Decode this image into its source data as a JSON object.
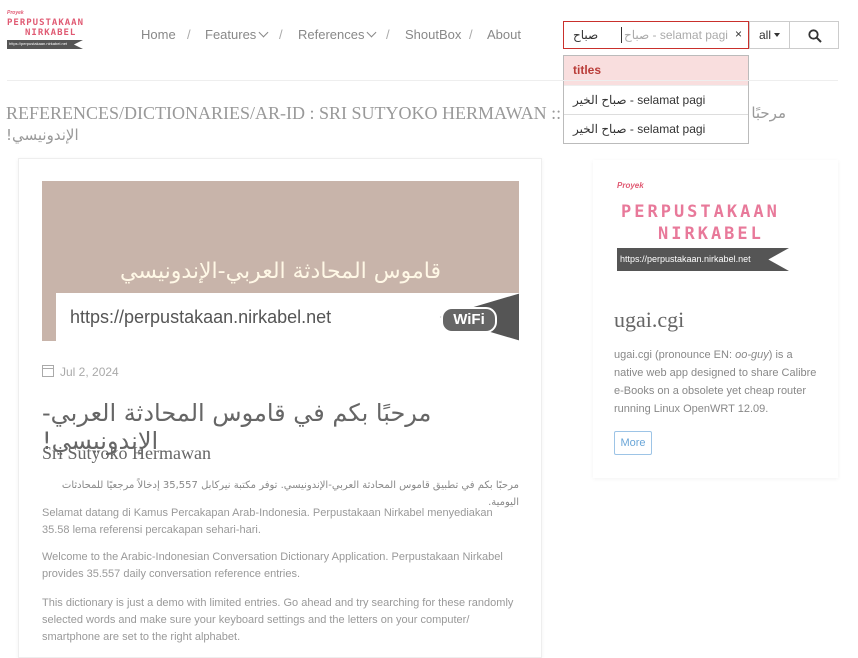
{
  "logo": {
    "small_label": "Proyek",
    "line1": "PERPUSTAKAAN",
    "line2": "NIRKABEL",
    "url": "https://perpustakaan.nirkabel.net"
  },
  "nav": {
    "home": "Home",
    "features": "Features",
    "references": "References",
    "shoutbox": "ShoutBox",
    "about": "About",
    "separator": "/"
  },
  "search": {
    "value": "صباح",
    "placeholder": "صباح - selamat pagi",
    "clear": "×",
    "scope": "all"
  },
  "suggestions": {
    "header": "titles",
    "items": [
      {
        "arabic": "صباح الخير",
        "latin": " - selamat pagi"
      },
      {
        "arabic": "صباح الخير",
        "latin": " - selamat pagi"
      }
    ]
  },
  "page_title": {
    "main": "REFERENCES/DICTIONARIES/AR-ID : SRI SUTYOKO HERMAWAN ::",
    "arabic_right": "مرحبًا",
    "arabic_line2": "الإندونيسي!"
  },
  "post": {
    "banner_arabic": "قاموس المحادثة العربي-الإندونيسي",
    "banner_url": "https://perpustakaan.nirkabel.net",
    "banner_badge": "WiFi",
    "date": "Jul 2, 2024",
    "heading": "مرحبًا بكم في قاموس المحادثة العربي-الإندونيسي!",
    "author": "Sri Sutyoko Hermawan",
    "para_ar": "مرحبًا بكم في تطبيق قاموس المحادثة العربي-الإندونيسي. توفر مكتبة نيركابل 35,557 إدخالاً مرجعيًا للمحادثات اليومية.",
    "para_id": "Selamat datang di Kamus Percakapan Arab-Indonesia. Perpustakaan Nirkabel menyediakan 35.58 lema referensi percakapan sehari-hari.",
    "para_en": "Welcome to the Arabic-Indonesian Conversation Dictionary Application. Perpustakaan Nirkabel provides 35.557 daily conversation reference entries.",
    "para_demo": "This dictionary is just a demo with limited entries. Go ahead and try searching for these randomly selected words and make sure your keyboard settings and the letters on your computer/ smartphone are set to the right alphabet."
  },
  "sidebar": {
    "small_label": "Proyek",
    "line1": "PERPUSTAKAAN",
    "line2": "NIRKABEL",
    "url": "https://perpustakaan.nirkabel.net",
    "title": "ugai.cgi",
    "desc_part1": "ugai.cgi (pronounce EN: ",
    "desc_italic": "oo-guy",
    "desc_part2": ") is a native web app designed to share Calibre e-Books on a obsolete yet cheap router running Linux OpenWRT 12.09.",
    "more": "More"
  },
  "colors": {
    "accent_red": "#c9302c",
    "brand_pink": "#e05a73",
    "link_blue": "#6aa6d8"
  }
}
